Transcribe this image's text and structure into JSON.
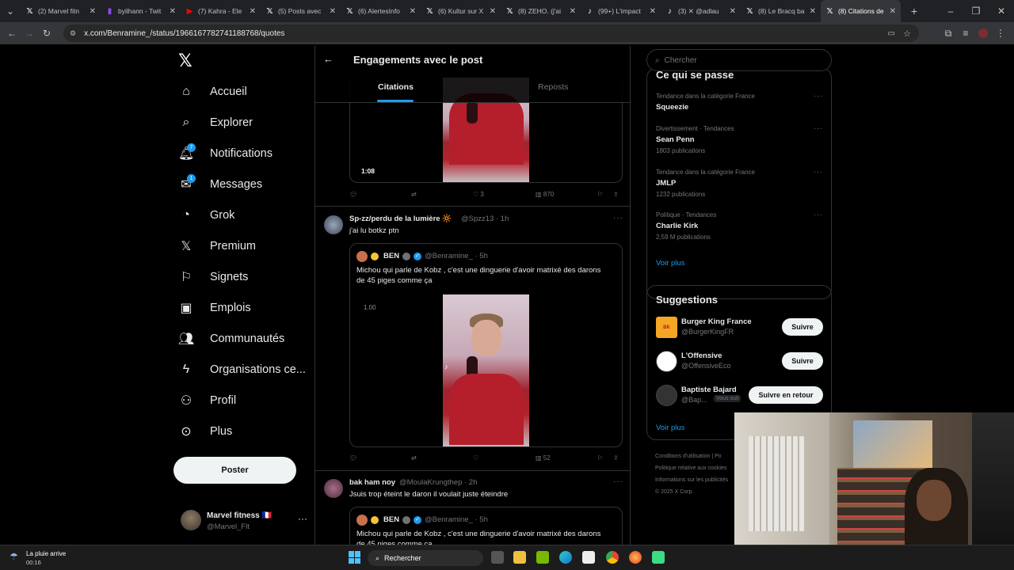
{
  "browser": {
    "tabs": [
      {
        "label": "(2) Marvel fitn",
        "icon": "x-icon"
      },
      {
        "label": "byilhann - Twit",
        "icon": "twitch-icon"
      },
      {
        "label": "(7) Kahra - Ele",
        "icon": "youtube-icon"
      },
      {
        "label": "(5) Posts avec",
        "icon": "x-icon"
      },
      {
        "label": "(6) AlertesInfo",
        "icon": "x-icon"
      },
      {
        "label": "(6) Kultur sur X",
        "icon": "x-icon"
      },
      {
        "label": "(8) ZEHO. (j'ai",
        "icon": "x-icon"
      },
      {
        "label": "(99+) L'impact",
        "icon": "tiktok-icon"
      },
      {
        "label": "(3) ✕ @adlau",
        "icon": "tiktok-icon"
      },
      {
        "label": "(8) Le Bracq ba",
        "icon": "x-icon"
      },
      {
        "label": "(8) Citations de",
        "icon": "x-icon"
      }
    ],
    "url": "x.com/Benramine_/status/1966167782741188768/quotes"
  },
  "nav": {
    "items": [
      {
        "label": "Accueil",
        "icon": "home-icon"
      },
      {
        "label": "Explorer",
        "icon": "search-icon"
      },
      {
        "label": "Notifications",
        "icon": "bell-icon",
        "badge": "7"
      },
      {
        "label": "Messages",
        "icon": "mail-icon",
        "badge": "1"
      },
      {
        "label": "Grok",
        "icon": "grok-icon"
      },
      {
        "label": "Premium",
        "icon": "x-logo-icon"
      },
      {
        "label": "Signets",
        "icon": "bookmark-icon"
      },
      {
        "label": "Emplois",
        "icon": "briefcase-icon"
      },
      {
        "label": "Communautés",
        "icon": "people-icon"
      },
      {
        "label": "Organisations ce...",
        "icon": "lightning-icon"
      },
      {
        "label": "Profil",
        "icon": "person-icon"
      },
      {
        "label": "Plus",
        "icon": "more-circle-icon"
      }
    ],
    "post_label": "Poster",
    "account": {
      "name": "Marvel fitness 🇫🇷",
      "handle": "@Marvel_Flt"
    }
  },
  "main": {
    "title": "Engagements avec le post",
    "tabs": [
      "Citations",
      "Reposts"
    ],
    "first_media": {
      "duration": "1:08",
      "likes": "3",
      "views": "870"
    },
    "posts": [
      {
        "name": "Sp-zz/perdu de la lumière 🔆",
        "handle": "@Spzz13 · 1h",
        "text": "j'ai lu botkz ptn",
        "quote": {
          "name": "BEN",
          "handle": "@Benramine_ · 5h",
          "text": "Michou qui parle de Kobz , c'est une dinguerie d'avoir matrixé des darons de 45 piges comme ça",
          "video_overlay": "1.00"
        },
        "views": "52"
      },
      {
        "name": "bak ham noy",
        "handle": "@MoulaKrungthep · 2h",
        "text": "Jsuis trop éteint le daron il voulait juste éteindre",
        "quote": {
          "name": "BEN",
          "handle": "@Benramine_ · 5h",
          "text": "Michou qui parle de Kobz , c'est une dinguerie d'avoir matrixé des darons de 45 piges comme ça"
        }
      }
    ]
  },
  "right": {
    "search_placeholder": "Chercher",
    "trends_title": "Ce qui se passe",
    "trends": [
      {
        "context": "Tendance dans la catégorie France",
        "name": "Squeezie",
        "count": ""
      },
      {
        "context": "Divertissement · Tendances",
        "name": "Sean Penn",
        "count": "1803 publications"
      },
      {
        "context": "Tendance dans la catégorie France",
        "name": "JMLP",
        "count": "1232 publications"
      },
      {
        "context": "Politique · Tendances",
        "name": "Charlie Kirk",
        "count": "2,59 M publications"
      }
    ],
    "show_more": "Voir plus",
    "suggestions_title": "Suggestions",
    "suggestions": [
      {
        "name": "Burger King France",
        "handle": "@BurgerKingFR",
        "button": "Suivre",
        "color": "#f5a623"
      },
      {
        "name": "L'Offensive",
        "handle": "@OffensiveEco",
        "button": "Suivre",
        "color": "#ffffff"
      },
      {
        "name": "Baptiste Bajard",
        "handle": "@Bap...",
        "follows_you": "Vous suit",
        "button": "Suivre en retour",
        "color": "#333333"
      }
    ],
    "footer": [
      "Conditions d'utilisation  |  Po",
      "Politique relative aux cookies",
      "Informations sur les publicités",
      "© 2025 X Corp."
    ]
  },
  "taskbar": {
    "weather_title": "La pluie arrive",
    "time": "00:16",
    "search": "Rechercher"
  }
}
